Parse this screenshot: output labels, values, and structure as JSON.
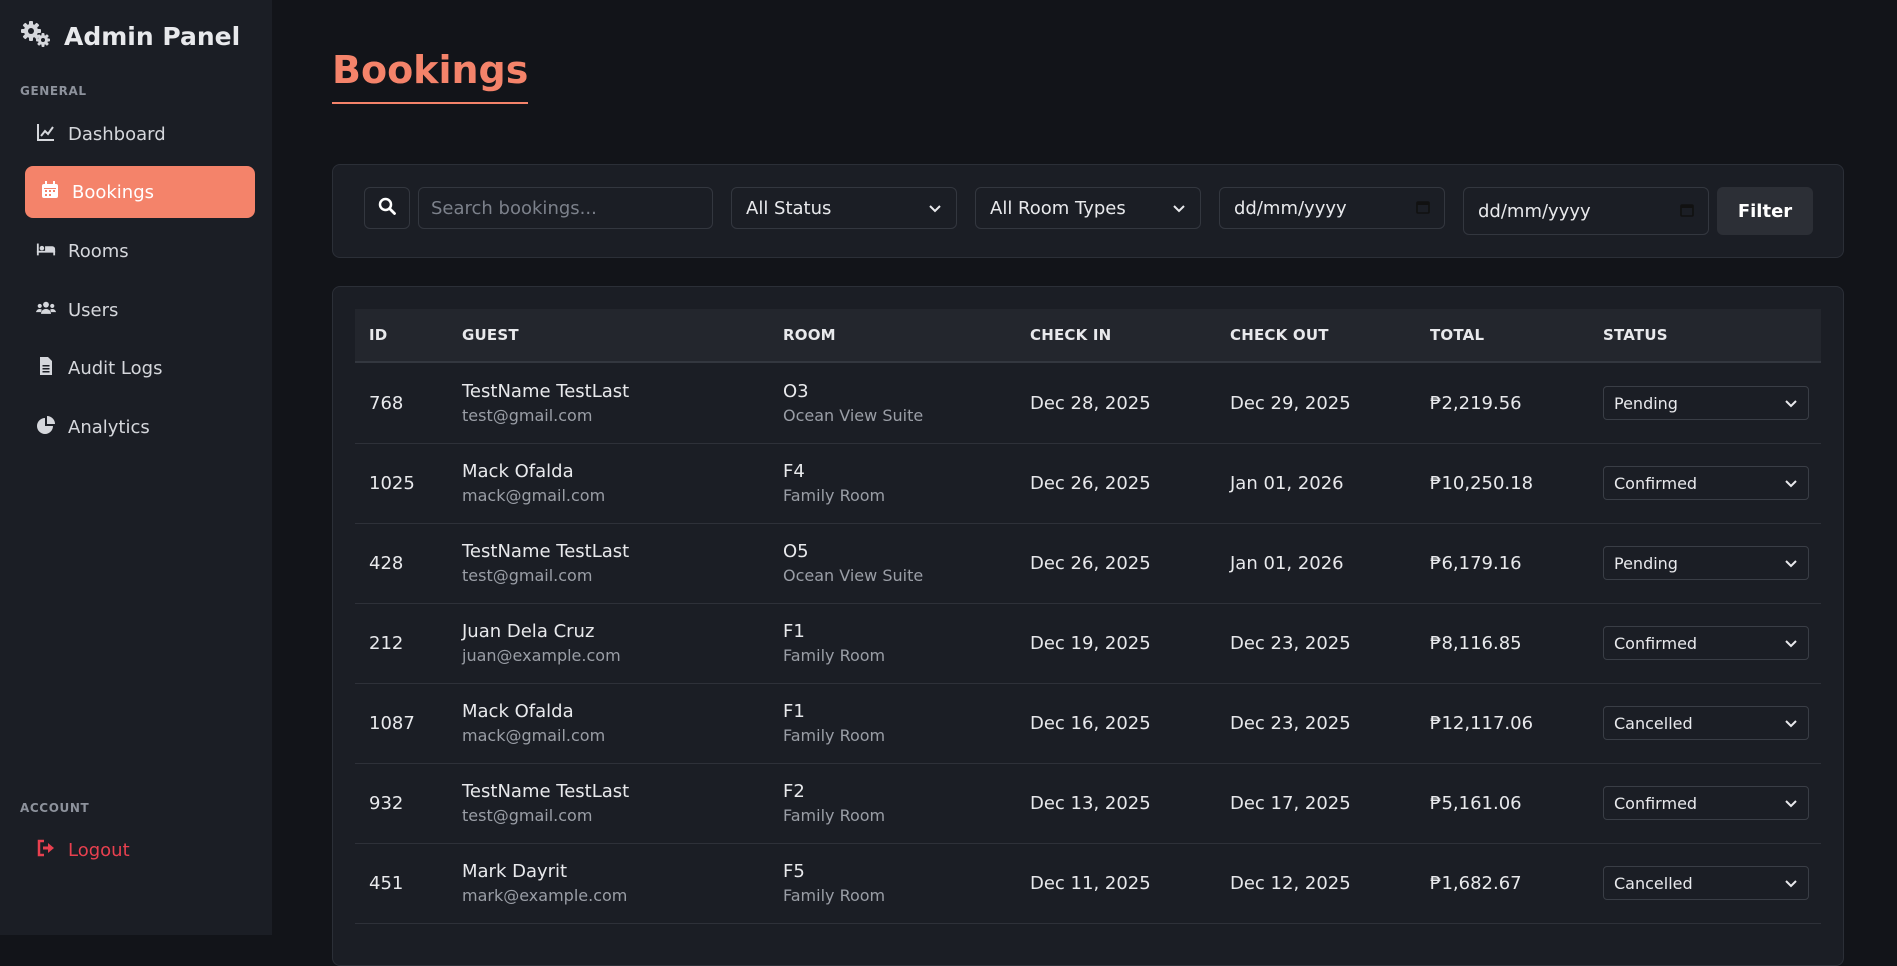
{
  "sidebar": {
    "brand": "Admin Panel",
    "general_label": "GENERAL",
    "items": [
      {
        "label": "Dashboard",
        "icon": "chart-line-icon"
      },
      {
        "label": "Bookings",
        "icon": "calendar-icon",
        "active": true
      },
      {
        "label": "Rooms",
        "icon": "bed-icon"
      },
      {
        "label": "Users",
        "icon": "users-icon"
      },
      {
        "label": "Audit Logs",
        "icon": "file-icon"
      },
      {
        "label": "Analytics",
        "icon": "pie-chart-icon"
      }
    ],
    "account_label": "ACCOUNT",
    "logout_label": "Logout"
  },
  "page": {
    "title": "Bookings"
  },
  "filters": {
    "search_placeholder": "Search bookings...",
    "status_value": "All Status",
    "room_type_value": "All Room Types",
    "date_from_placeholder": "dd/mm/yyyy",
    "date_to_placeholder": "dd/mm/yyyy",
    "filter_label": "Filter"
  },
  "table": {
    "headers": {
      "id": "ID",
      "guest": "GUEST",
      "room": "ROOM",
      "check_in": "CHECK IN",
      "check_out": "CHECK OUT",
      "total": "TOTAL",
      "status": "STATUS"
    },
    "rows": [
      {
        "id": "768",
        "guest_name": "TestName TestLast",
        "guest_email": "test@gmail.com",
        "room_code": "O3",
        "room_type": "Ocean View Suite",
        "check_in": "Dec 28, 2025",
        "check_out": "Dec 29, 2025",
        "total": "₱2,219.56",
        "status": "Pending"
      },
      {
        "id": "1025",
        "guest_name": "Mack Ofalda",
        "guest_email": "mack@gmail.com",
        "room_code": "F4",
        "room_type": "Family Room",
        "check_in": "Dec 26, 2025",
        "check_out": "Jan 01, 2026",
        "total": "₱10,250.18",
        "status": "Confirmed"
      },
      {
        "id": "428",
        "guest_name": "TestName TestLast",
        "guest_email": "test@gmail.com",
        "room_code": "O5",
        "room_type": "Ocean View Suite",
        "check_in": "Dec 26, 2025",
        "check_out": "Jan 01, 2026",
        "total": "₱6,179.16",
        "status": "Pending"
      },
      {
        "id": "212",
        "guest_name": "Juan Dela Cruz",
        "guest_email": "juan@example.com",
        "room_code": "F1",
        "room_type": "Family Room",
        "check_in": "Dec 19, 2025",
        "check_out": "Dec 23, 2025",
        "total": "₱8,116.85",
        "status": "Confirmed"
      },
      {
        "id": "1087",
        "guest_name": "Mack Ofalda",
        "guest_email": "mack@gmail.com",
        "room_code": "F1",
        "room_type": "Family Room",
        "check_in": "Dec 16, 2025",
        "check_out": "Dec 23, 2025",
        "total": "₱12,117.06",
        "status": "Cancelled"
      },
      {
        "id": "932",
        "guest_name": "TestName TestLast",
        "guest_email": "test@gmail.com",
        "room_code": "F2",
        "room_type": "Family Room",
        "check_in": "Dec 13, 2025",
        "check_out": "Dec 17, 2025",
        "total": "₱5,161.06",
        "status": "Confirmed"
      },
      {
        "id": "451",
        "guest_name": "Mark Dayrit",
        "guest_email": "mark@example.com",
        "room_code": "F5",
        "room_type": "Family Room",
        "check_in": "Dec 11, 2025",
        "check_out": "Dec 12, 2025",
        "total": "₱1,682.67",
        "status": "Cancelled"
      }
    ]
  },
  "colors": {
    "accent": "#f4836a",
    "danger": "#e8404f",
    "background": "#121419",
    "panel": "#1b1e25"
  }
}
